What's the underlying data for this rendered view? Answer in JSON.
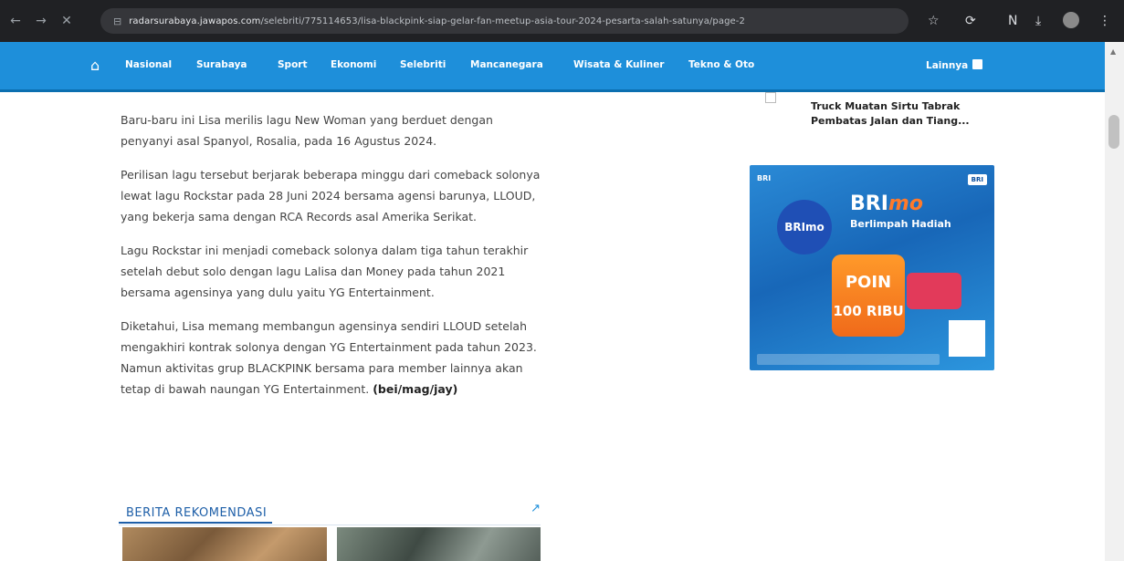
{
  "browser": {
    "url_domain": "radarsurabaya.jawapos.com",
    "url_path": "/selebriti/775114653/lisa-blackpink-siap-gelar-fan-meetup-asia-tour-2024-pesarta-salah-satunya/page-2",
    "back_icon": "arrow-left-icon",
    "forward_icon": "arrow-right-icon",
    "reload_icon": "reload-icon"
  },
  "site_nav": {
    "home_icon": "home-icon",
    "items": [
      {
        "label": "Nasional"
      },
      {
        "label": "Surabaya"
      },
      {
        "label": "Sport"
      },
      {
        "label": "Ekonomi"
      },
      {
        "label": "Selebriti"
      },
      {
        "label": "Mancanegara"
      },
      {
        "label": "Wisata & Kuliner"
      },
      {
        "label": "Tekno & Oto"
      }
    ],
    "more_label": "Lainnya"
  },
  "article": {
    "paragraphs": [
      "Baru-baru ini Lisa merilis lagu New Woman yang berduet dengan penyanyi asal Spanyol, Rosalia, pada 16 Agustus 2024.",
      "Perilisan lagu tersebut berjarak beberapa minggu dari comeback solonya lewat lagu Rockstar pada 28 Juni 2024 bersama agensi barunya, LLOUD, yang bekerja sama dengan RCA Records asal Amerika Serikat.",
      "Lagu Rockstar ini menjadi comeback solonya dalam tiga tahun terakhir setelah debut solo dengan lagu Lalisa dan Money pada tahun 2021 bersama agensinya yang dulu yaitu YG Entertainment."
    ],
    "last_paragraph": "Diketahui, Lisa memang membangun agensinya sendiri LLOUD setelah mengakhiri kontrak solonya dengan YG Entertainment pada tahun 2023. Namun aktivitas grup BLACKPINK bersama para member lainnya akan tetap di bawah naungan YG Entertainment.",
    "credit": "(bei/mag/jay)"
  },
  "rekomendasi": {
    "title": "BERITA REKOMENDASI"
  },
  "sidebar": {
    "related_title": "Truck Muatan Sirtu Tabrak Pembatas Jalan dan Tiang..."
  },
  "ad": {
    "brand": "BRImo",
    "headline": "Berlimpah Hadiah",
    "circle_text": "BRImo",
    "poin_text": "POIN",
    "reward_text": "100 RIBU",
    "logo_text": "BRI"
  }
}
